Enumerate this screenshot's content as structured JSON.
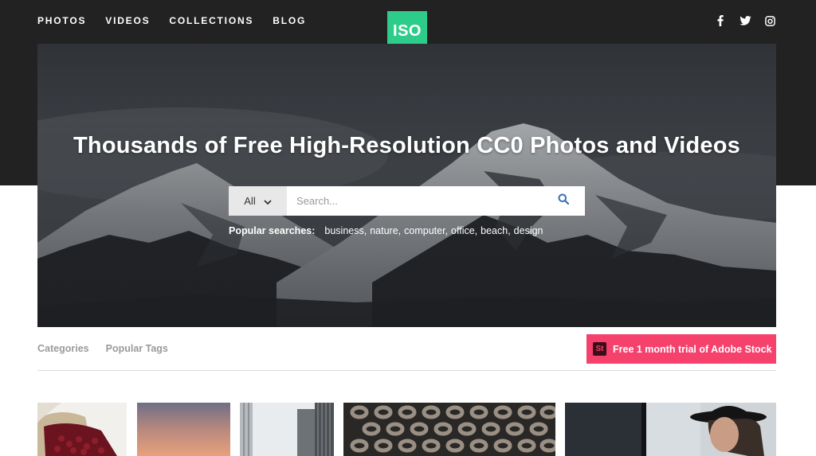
{
  "nav": {
    "items": [
      "PHOTOS",
      "VIDEOS",
      "COLLECTIONS",
      "BLOG"
    ]
  },
  "logo": {
    "text": "ISO",
    "color": "#2ecc8a"
  },
  "social": {
    "icons": [
      "facebook-icon",
      "twitter-icon",
      "instagram-icon"
    ]
  },
  "hero": {
    "title": "Thousands of Free High-Resolution CC0 Photos and Videos",
    "search": {
      "category": "All",
      "placeholder": "Search...",
      "button_icon": "search-icon"
    },
    "popular": {
      "label": "Popular searches:",
      "terms": [
        "business,",
        "nature,",
        "computer,",
        "office,",
        "beach,",
        "design"
      ]
    }
  },
  "subnav": {
    "items": [
      "Categories",
      "Popular Tags"
    ]
  },
  "promo": {
    "badge": "St",
    "text": "Free 1 month trial of Adobe Stock",
    "color": "#f5416c"
  },
  "thumbnails": [
    {
      "name": "coffee-beans-photo"
    },
    {
      "name": "sunset-sky-photo"
    },
    {
      "name": "buildings-photo"
    },
    {
      "name": "chain-links-photo"
    },
    {
      "name": "woman-hat-photo"
    }
  ]
}
